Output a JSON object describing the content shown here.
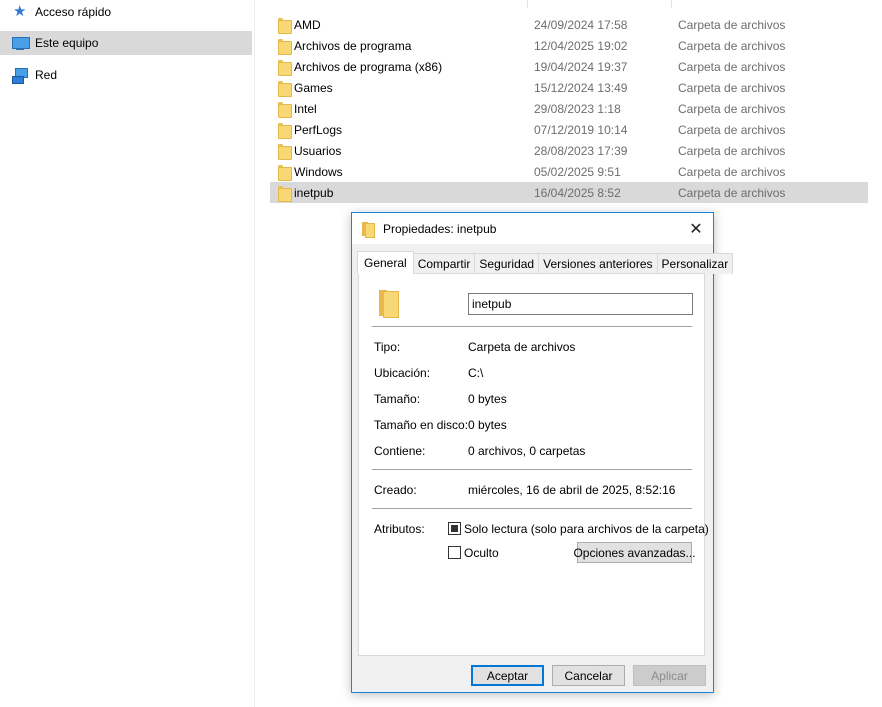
{
  "nav": {
    "items": [
      {
        "label": "Acceso rápido",
        "icon": "star-icon",
        "selected": false
      },
      {
        "label": "Este equipo",
        "icon": "pc-icon",
        "selected": true
      },
      {
        "label": "Red",
        "icon": "network-icon",
        "selected": false
      }
    ]
  },
  "files": [
    {
      "name": "AMD",
      "date": "24/09/2024 17:58",
      "type": "Carpeta de archivos"
    },
    {
      "name": "Archivos de programa",
      "date": "12/04/2025 19:02",
      "type": "Carpeta de archivos"
    },
    {
      "name": "Archivos de programa (x86)",
      "date": "19/04/2024 19:37",
      "type": "Carpeta de archivos"
    },
    {
      "name": "Games",
      "date": "15/12/2024 13:49",
      "type": "Carpeta de archivos"
    },
    {
      "name": "Intel",
      "date": "29/08/2023 1:18",
      "type": "Carpeta de archivos"
    },
    {
      "name": "PerfLogs",
      "date": "07/12/2019 10:14",
      "type": "Carpeta de archivos"
    },
    {
      "name": "Usuarios",
      "date": "28/08/2023 17:39",
      "type": "Carpeta de archivos"
    },
    {
      "name": "Windows",
      "date": "05/02/2025 9:51",
      "type": "Carpeta de archivos"
    },
    {
      "name": "inetpub",
      "date": "16/04/2025 8:52",
      "type": "Carpeta de archivos"
    }
  ],
  "dialog": {
    "title": "Propiedades: inetpub",
    "close_label": "✕",
    "tabs": [
      "General",
      "Compartir",
      "Seguridad",
      "Versiones anteriores",
      "Personalizar"
    ],
    "name_value": "inetpub",
    "props": [
      {
        "label": "Tipo:",
        "value": "Carpeta de archivos"
      },
      {
        "label": "Ubicación:",
        "value": "C:\\"
      },
      {
        "label": "Tamaño:",
        "value": "0 bytes"
      },
      {
        "label": "Tamaño en disco:",
        "value": "0 bytes"
      },
      {
        "label": "Contiene:",
        "value": "0 archivos, 0 carpetas"
      }
    ],
    "created_label": "Creado:",
    "created_value": "miércoles, 16 de abril de 2025, 8:52:16",
    "attributes_label": "Atributos:",
    "readonly_label": "Solo lectura (solo para archivos de la carpeta)",
    "hidden_label": "Oculto",
    "advanced_label": "Opciones avanzadas...",
    "ok_label": "Aceptar",
    "cancel_label": "Cancelar",
    "apply_label": "Aplicar"
  }
}
